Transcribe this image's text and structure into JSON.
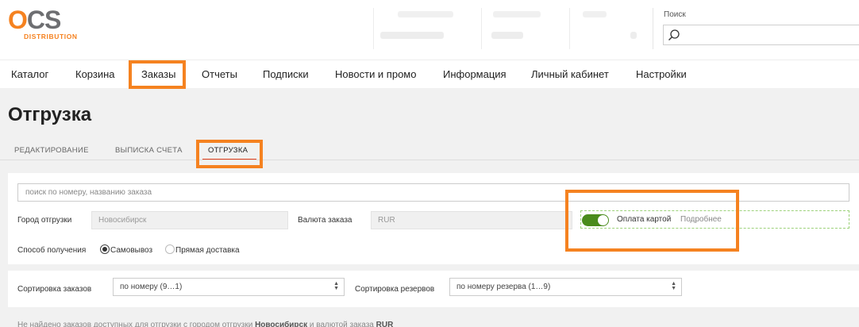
{
  "logo": {
    "ocs": "OCS",
    "distribution": "DISTRIBUTION"
  },
  "search": {
    "label": "Поиск",
    "placeholder": ""
  },
  "nav": {
    "items": [
      "Каталог",
      "Корзина",
      "Заказы",
      "Отчеты",
      "Подписки",
      "Новости и промо",
      "Информация",
      "Личный кабинет",
      "Настройки"
    ],
    "active": "Заказы"
  },
  "page": {
    "title": "Отгрузка"
  },
  "tabs": [
    "РЕДАКТИРОВАНИЕ",
    "ВЫПИСКА СЧЕТА",
    "ОТГРУЗКА"
  ],
  "filters": {
    "search_placeholder": "поиск по номеру, названию заказа",
    "city_label": "Город отгрузки",
    "city_value": "Новосибирск",
    "currency_label": "Валюта заказа",
    "currency_value": "RUR",
    "card_payment_label": "Оплата картой",
    "card_payment_more": "Подробнее",
    "card_payment_on": true,
    "delivery_label": "Способ получения",
    "delivery_options": [
      "Самовывоз",
      "Прямая доставка"
    ],
    "delivery_selected": "Самовывоз"
  },
  "sorting": {
    "orders_label": "Сортировка заказов",
    "orders_value": "по номеру (9…1)",
    "reserves_label": "Сортировка резервов",
    "reserves_value": "по номеру резерва (1…9)"
  },
  "footer": {
    "text_part1": "Не найдено заказов доступных для отгрузки с городом отгрузки ",
    "city": "Новосибирск",
    "text_part2": " и валютой заказа ",
    "currency": "RUR"
  },
  "colors": {
    "accent": "#f58220",
    "toggle_on": "#4a8c1c",
    "tab_underline": "#e2401c"
  }
}
